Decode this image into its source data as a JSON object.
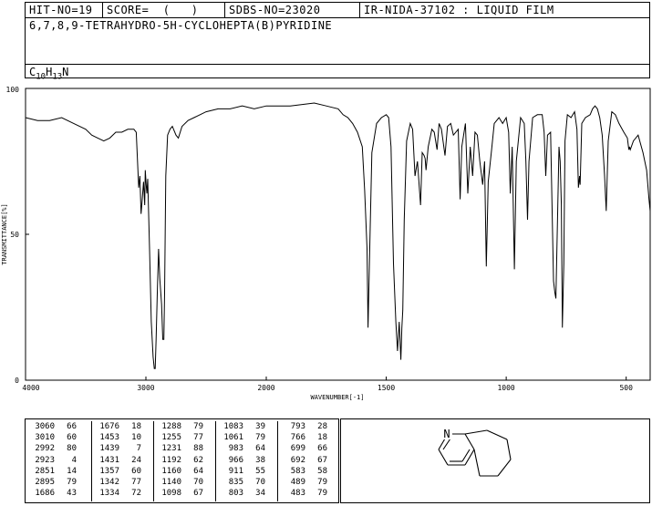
{
  "header": {
    "hit_no": "HIT-NO=19",
    "score": "SCORE=  (   )",
    "sdbs_no": "SDBS-NO=23020",
    "ir_id": "IR-NIDA-37102 : LIQUID FILM",
    "compound_name": "6,7,8,9-TETRAHYDRO-5H-CYCLOHEPTA(B)PYRIDINE",
    "formula_c": "C",
    "formula_c_count": "10",
    "formula_h": "H",
    "formula_h_count": "13",
    "formula_n": "N"
  },
  "chart_data": {
    "type": "line",
    "title": "",
    "xlabel": "WAVENUMBER[-1]",
    "ylabel": "TRANSMITTANCE[%]",
    "xlim": [
      4000,
      400
    ],
    "ylim": [
      0,
      100
    ],
    "x_ticks": [
      4000,
      3000,
      2000,
      1500,
      1000,
      500
    ],
    "y_ticks": [
      0,
      50,
      100
    ],
    "grid": false,
    "series": [
      {
        "points": [
          [
            4000,
            90
          ],
          [
            3900,
            89
          ],
          [
            3800,
            89
          ],
          [
            3700,
            90
          ],
          [
            3600,
            88
          ],
          [
            3500,
            86
          ],
          [
            3450,
            84
          ],
          [
            3400,
            83
          ],
          [
            3350,
            82
          ],
          [
            3300,
            83
          ],
          [
            3250,
            85
          ],
          [
            3200,
            85
          ],
          [
            3150,
            86
          ],
          [
            3100,
            86
          ],
          [
            3080,
            85
          ],
          [
            3060,
            66
          ],
          [
            3050,
            70
          ],
          [
            3040,
            57
          ],
          [
            3030,
            62
          ],
          [
            3020,
            68
          ],
          [
            3010,
            60
          ],
          [
            3005,
            72
          ],
          [
            2998,
            67
          ],
          [
            2992,
            64
          ],
          [
            2985,
            69
          ],
          [
            2970,
            45
          ],
          [
            2955,
            20
          ],
          [
            2940,
            8
          ],
          [
            2930,
            4
          ],
          [
            2923,
            4
          ],
          [
            2915,
            14
          ],
          [
            2905,
            30
          ],
          [
            2895,
            45
          ],
          [
            2885,
            35
          ],
          [
            2870,
            26
          ],
          [
            2860,
            14
          ],
          [
            2851,
            14
          ],
          [
            2845,
            30
          ],
          [
            2835,
            70
          ],
          [
            2820,
            84
          ],
          [
            2800,
            86
          ],
          [
            2780,
            87
          ],
          [
            2750,
            84
          ],
          [
            2730,
            83
          ],
          [
            2700,
            87
          ],
          [
            2650,
            89
          ],
          [
            2600,
            90
          ],
          [
            2550,
            91
          ],
          [
            2500,
            92
          ],
          [
            2400,
            93
          ],
          [
            2300,
            93
          ],
          [
            2200,
            94
          ],
          [
            2100,
            93
          ],
          [
            2000,
            94
          ],
          [
            1900,
            94
          ],
          [
            1800,
            95
          ],
          [
            1750,
            94
          ],
          [
            1700,
            93
          ],
          [
            1680,
            91
          ],
          [
            1660,
            90
          ],
          [
            1640,
            88
          ],
          [
            1620,
            85
          ],
          [
            1600,
            80
          ],
          [
            1590,
            65
          ],
          [
            1580,
            45
          ],
          [
            1576,
            18
          ],
          [
            1570,
            40
          ],
          [
            1560,
            78
          ],
          [
            1540,
            88
          ],
          [
            1520,
            90
          ],
          [
            1500,
            91
          ],
          [
            1490,
            90
          ],
          [
            1480,
            80
          ],
          [
            1470,
            40
          ],
          [
            1460,
            20
          ],
          [
            1453,
            10
          ],
          [
            1446,
            20
          ],
          [
            1439,
            7
          ],
          [
            1435,
            18
          ],
          [
            1431,
            24
          ],
          [
            1425,
            55
          ],
          [
            1415,
            82
          ],
          [
            1400,
            88
          ],
          [
            1390,
            86
          ],
          [
            1380,
            70
          ],
          [
            1370,
            75
          ],
          [
            1357,
            60
          ],
          [
            1350,
            78
          ],
          [
            1342,
            77
          ],
          [
            1338,
            76
          ],
          [
            1334,
            72
          ],
          [
            1325,
            80
          ],
          [
            1310,
            86
          ],
          [
            1300,
            85
          ],
          [
            1288,
            79
          ],
          [
            1280,
            88
          ],
          [
            1270,
            86
          ],
          [
            1255,
            77
          ],
          [
            1245,
            87
          ],
          [
            1231,
            88
          ],
          [
            1220,
            84
          ],
          [
            1200,
            86
          ],
          [
            1192,
            62
          ],
          [
            1185,
            80
          ],
          [
            1170,
            88
          ],
          [
            1160,
            64
          ],
          [
            1150,
            80
          ],
          [
            1140,
            70
          ],
          [
            1130,
            85
          ],
          [
            1120,
            84
          ],
          [
            1110,
            75
          ],
          [
            1098,
            67
          ],
          [
            1090,
            75
          ],
          [
            1083,
            39
          ],
          [
            1075,
            68
          ],
          [
            1061,
            79
          ],
          [
            1050,
            88
          ],
          [
            1030,
            90
          ],
          [
            1015,
            88
          ],
          [
            1000,
            90
          ],
          [
            990,
            85
          ],
          [
            983,
            64
          ],
          [
            975,
            80
          ],
          [
            966,
            38
          ],
          [
            958,
            75
          ],
          [
            940,
            90
          ],
          [
            925,
            88
          ],
          [
            918,
            75
          ],
          [
            911,
            55
          ],
          [
            905,
            75
          ],
          [
            890,
            90
          ],
          [
            870,
            91
          ],
          [
            850,
            91
          ],
          [
            842,
            85
          ],
          [
            835,
            70
          ],
          [
            828,
            84
          ],
          [
            815,
            85
          ],
          [
            803,
            34
          ],
          [
            797,
            30
          ],
          [
            793,
            28
          ],
          [
            785,
            60
          ],
          [
            780,
            80
          ],
          [
            775,
            75
          ],
          [
            770,
            60
          ],
          [
            766,
            18
          ],
          [
            760,
            40
          ],
          [
            755,
            82
          ],
          [
            745,
            91
          ],
          [
            730,
            90
          ],
          [
            715,
            92
          ],
          [
            705,
            86
          ],
          [
            699,
            66
          ],
          [
            694,
            70
          ],
          [
            692,
            67
          ],
          [
            685,
            88
          ],
          [
            670,
            90
          ],
          [
            650,
            91
          ],
          [
            640,
            93
          ],
          [
            630,
            94
          ],
          [
            620,
            93
          ],
          [
            610,
            90
          ],
          [
            600,
            84
          ],
          [
            590,
            70
          ],
          [
            583,
            58
          ],
          [
            575,
            82
          ],
          [
            560,
            92
          ],
          [
            545,
            91
          ],
          [
            530,
            88
          ],
          [
            510,
            85
          ],
          [
            495,
            83
          ],
          [
            489,
            79
          ],
          [
            486,
            80
          ],
          [
            483,
            79
          ],
          [
            470,
            82
          ],
          [
            450,
            84
          ],
          [
            430,
            78
          ],
          [
            415,
            72
          ],
          [
            405,
            62
          ],
          [
            400,
            58
          ]
        ]
      }
    ]
  },
  "peak_table": {
    "columns": [
      [
        [
          "3060",
          "66"
        ],
        [
          "3010",
          "60"
        ],
        [
          "2992",
          "80"
        ],
        [
          "2923",
          "4"
        ],
        [
          "2851",
          "14"
        ],
        [
          "2895",
          "79"
        ],
        [
          "1686",
          "43"
        ]
      ],
      [
        [
          "1676",
          "18"
        ],
        [
          "1453",
          "10"
        ],
        [
          "1439",
          "7"
        ],
        [
          "1431",
          "24"
        ],
        [
          "1357",
          "60"
        ],
        [
          "1342",
          "77"
        ],
        [
          "1334",
          "72"
        ]
      ],
      [
        [
          "1288",
          "79"
        ],
        [
          "1255",
          "77"
        ],
        [
          "1231",
          "88"
        ],
        [
          "1192",
          "62"
        ],
        [
          "1160",
          "64"
        ],
        [
          "1140",
          "70"
        ],
        [
          "1098",
          "67"
        ]
      ],
      [
        [
          "1083",
          "39"
        ],
        [
          "1061",
          "79"
        ],
        [
          "983",
          "64"
        ],
        [
          "966",
          "38"
        ],
        [
          "911",
          "55"
        ],
        [
          "835",
          "70"
        ],
        [
          "803",
          "34"
        ]
      ],
      [
        [
          "793",
          "28"
        ],
        [
          "766",
          "18"
        ],
        [
          "699",
          "66"
        ],
        [
          "692",
          "67"
        ],
        [
          "583",
          "58"
        ],
        [
          "489",
          "79"
        ],
        [
          "483",
          "79"
        ]
      ]
    ]
  },
  "structure": {
    "heteroatom_label": "N"
  }
}
